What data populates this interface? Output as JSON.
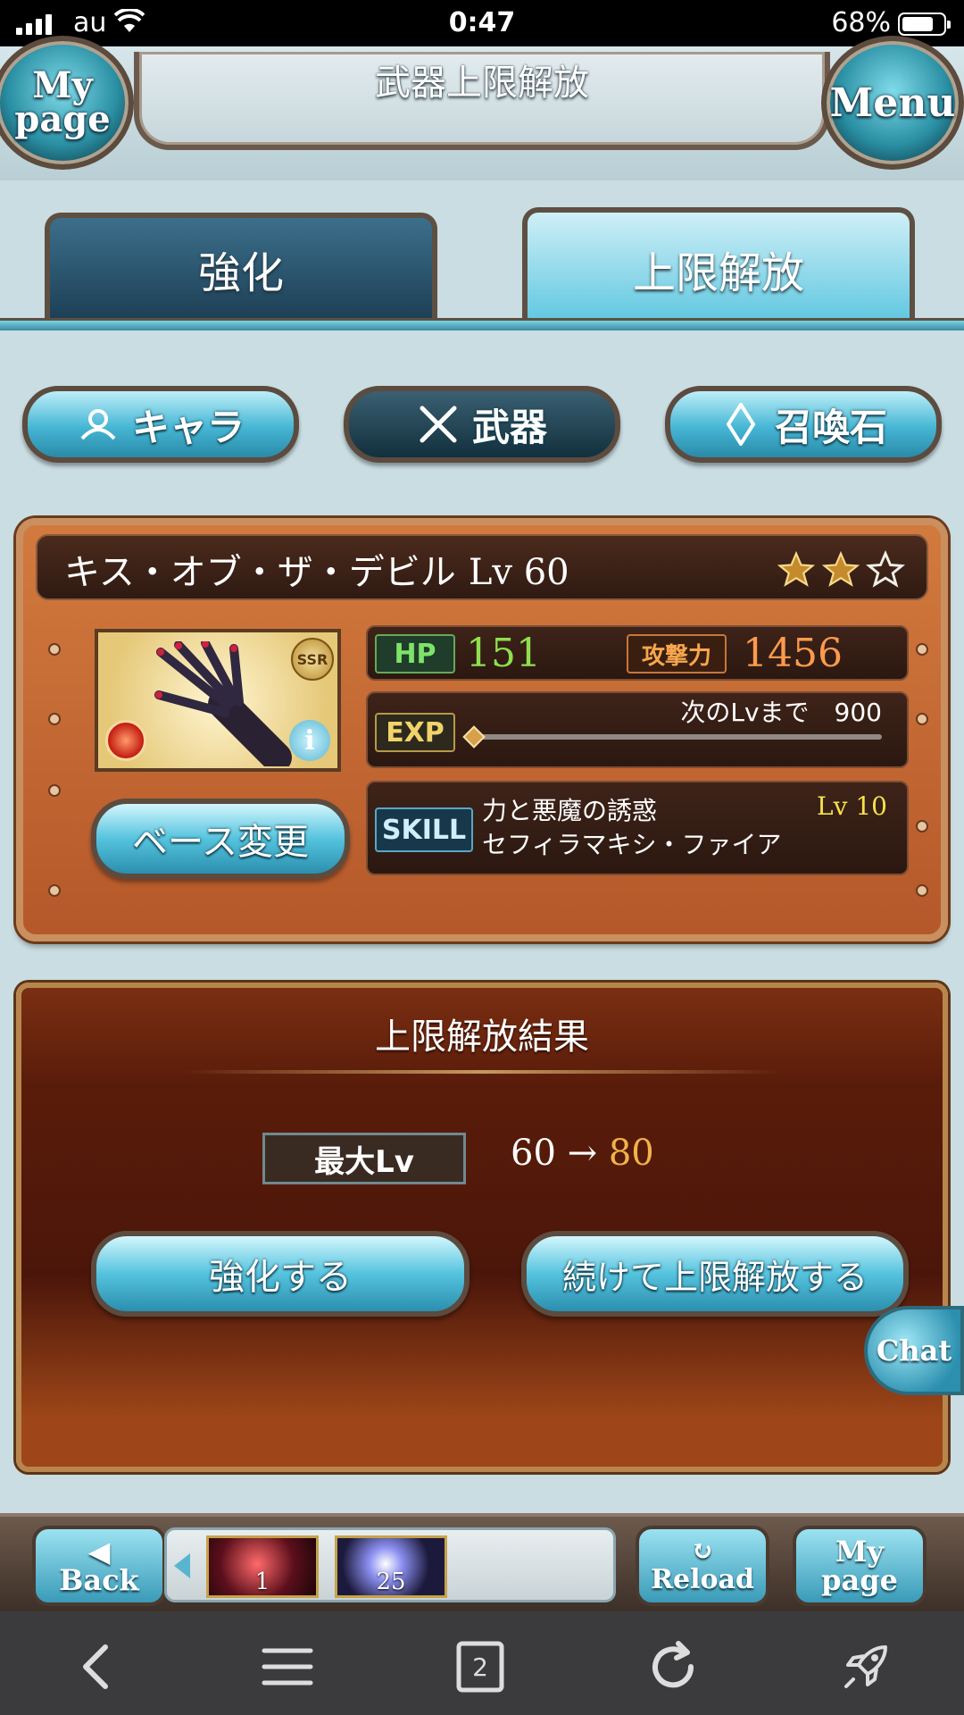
{
  "status_bar": {
    "carrier": "au",
    "time": "0:47",
    "battery": "68%"
  },
  "header": {
    "title": "武器上限解放",
    "mypage_label_1": "My",
    "mypage_label_2": "page",
    "menu_label": "Menu"
  },
  "tabs": [
    {
      "label": "強化",
      "active": false
    },
    {
      "label": "上限解放",
      "active": true
    }
  ],
  "categories": [
    {
      "label": "キャラ",
      "icon": "chara-icon",
      "active": false
    },
    {
      "label": "武器",
      "icon": "swords-icon",
      "active": true
    },
    {
      "label": "召喚石",
      "icon": "crystal-icon",
      "active": false
    }
  ],
  "weapon": {
    "name": "キス・オブ・ザ・デビル",
    "level": "Lv 60",
    "rarity": "SSR",
    "uncap_stars_filled": 2,
    "uncap_stars_total": 3,
    "hp_label": "HP",
    "hp": "151",
    "atk_label": "攻撃力",
    "atk": "1456",
    "exp_label": "EXP",
    "exp_next": "次のLvまで　900",
    "exp_progress": 0,
    "skill_label": "SKILL",
    "skill_name": "力と悪魔の誘惑",
    "skill_sub": "セフィラマキシ・ファイア",
    "skill_level": "Lv  10",
    "base_change_label": "ベース変更"
  },
  "result": {
    "title": "上限解放結果",
    "max_lv_label": "最大Lv",
    "from": "60",
    "arrow": "→",
    "to": "80",
    "enhance_button": "強化する",
    "continue_button": "続けて上限解放する"
  },
  "chat_label": "Chat",
  "gamebar": {
    "back_label": "Back",
    "reload_label": "Reload",
    "mypage_label_1": "My",
    "mypage_label_2": "page",
    "items": [
      {
        "count": "1"
      },
      {
        "count": "25"
      }
    ]
  },
  "browser": {
    "tab_count": "2"
  },
  "colors": {
    "accent_blue": "#45b6d4",
    "panel_orange": "#d27a3e",
    "hp_green": "#8ee04e",
    "atk_orange": "#ff9a4c",
    "skill_lv_yellow": "#f7e24a",
    "result_to": "#f2b24a"
  }
}
